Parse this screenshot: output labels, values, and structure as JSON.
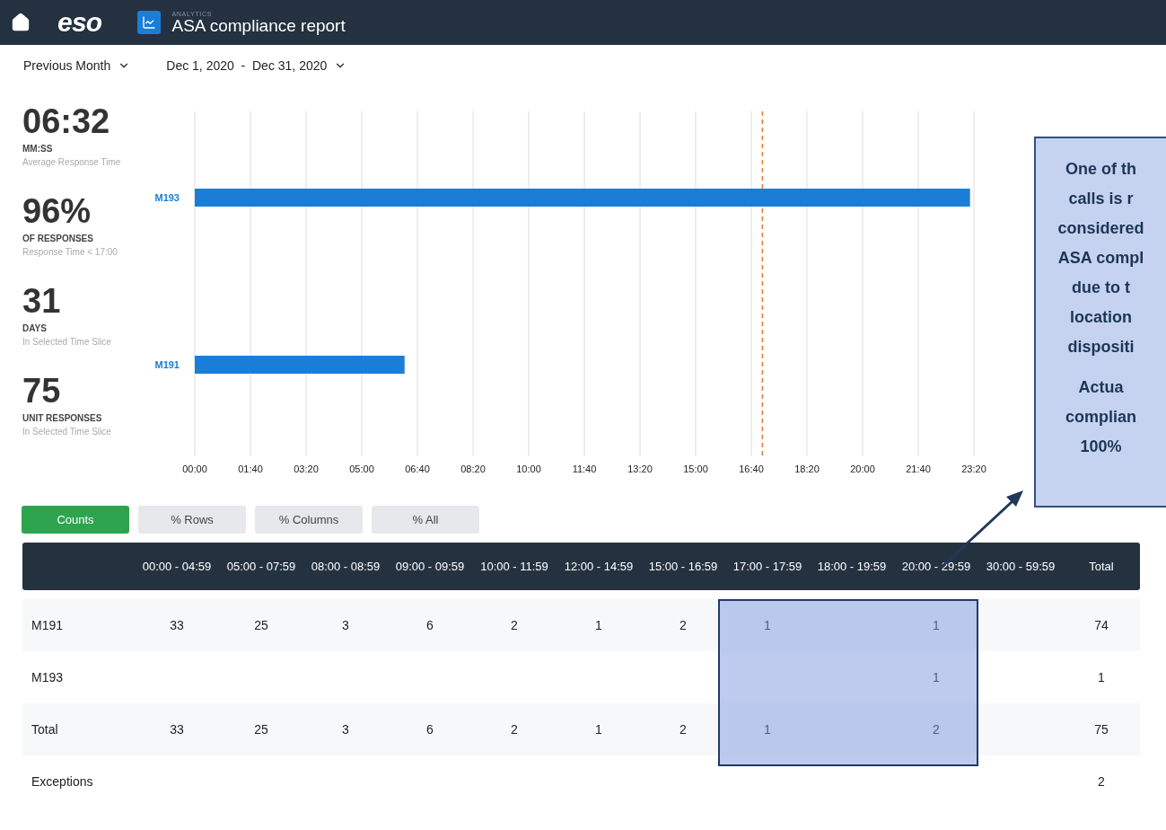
{
  "header": {
    "logo": "eso",
    "section": "ANALYTICS",
    "title": "ASA compliance report"
  },
  "filters": {
    "period": "Previous Month",
    "range": "Dec 1, 2020  -  Dec 31, 2020"
  },
  "stats": [
    {
      "value": "06:32",
      "label": "MM:SS",
      "caption": "Average Response Time"
    },
    {
      "value": "96%",
      "label": "OF RESPONSES",
      "caption": "Response Time < 17:00"
    },
    {
      "value": "31",
      "label": "DAYS",
      "caption": "In Selected Time Slice"
    },
    {
      "value": "75",
      "label": "UNIT RESPONSES",
      "caption": "In Selected Time Slice"
    }
  ],
  "chart_data": {
    "type": "bar",
    "orientation": "horizontal",
    "categories": [
      "M193",
      "M191"
    ],
    "series": [
      {
        "color": "#1a7ed8",
        "values": [
          1393,
          377
        ]
      }
    ],
    "grid": true,
    "xlim": [
      0,
      1400
    ],
    "xticks": [
      {
        "value": 0,
        "label": "00:00"
      },
      {
        "value": 100,
        "label": "01:40"
      },
      {
        "value": 200,
        "label": "03:20"
      },
      {
        "value": 300,
        "label": "05:00"
      },
      {
        "value": 400,
        "label": "06:40"
      },
      {
        "value": 500,
        "label": "08:20"
      },
      {
        "value": 600,
        "label": "10:00"
      },
      {
        "value": 700,
        "label": "11:40"
      },
      {
        "value": 800,
        "label": "13:20"
      },
      {
        "value": 900,
        "label": "15:00"
      },
      {
        "value": 1000,
        "label": "16:40"
      },
      {
        "value": 1100,
        "label": "18:20"
      },
      {
        "value": 1200,
        "label": "20:00"
      },
      {
        "value": 1300,
        "label": "21:40"
      },
      {
        "value": 1400,
        "label": "23:20"
      }
    ],
    "ref_lines": [
      {
        "axis": "x",
        "value": 1020,
        "color": "#e07a3a"
      }
    ]
  },
  "view_tabs": [
    {
      "label": "Counts",
      "selected": true
    },
    {
      "label": "% Rows",
      "selected": false
    },
    {
      "label": "% Columns",
      "selected": false
    },
    {
      "label": "% All",
      "selected": false
    }
  ],
  "table": {
    "columns": [
      "00:00 - 04:59",
      "05:00 - 07:59",
      "08:00 - 08:59",
      "09:00 - 09:59",
      "10:00 - 11:59",
      "12:00 - 14:59",
      "15:00 - 16:59",
      "17:00 - 17:59",
      "18:00 - 19:59",
      "20:00 - 29:59",
      "30:00 - 59:59"
    ],
    "total_label": "Total",
    "rows": [
      {
        "label": "M191",
        "cells": [
          "33",
          "25",
          "3",
          "6",
          "2",
          "1",
          "2",
          "1",
          "",
          "1",
          ""
        ],
        "total": "74"
      },
      {
        "label": "M193",
        "cells": [
          "",
          "",
          "",
          "",
          "",
          "",
          "",
          "",
          "",
          "1",
          ""
        ],
        "total": "1"
      },
      {
        "label": "Total",
        "cells": [
          "33",
          "25",
          "3",
          "6",
          "2",
          "1",
          "2",
          "1",
          "",
          "2",
          ""
        ],
        "total": "75"
      },
      {
        "label": "Exceptions",
        "cells": [
          "",
          "",
          "",
          "",
          "",
          "",
          "",
          "",
          "",
          "",
          ""
        ],
        "total": "2"
      }
    ]
  },
  "callout": {
    "paragraphs": [
      [
        "One of th",
        "calls is r",
        "considered",
        "ASA compl",
        "due to t",
        "location",
        "dispositi"
      ],
      [
        "Actua",
        "complian",
        "100%"
      ]
    ]
  }
}
